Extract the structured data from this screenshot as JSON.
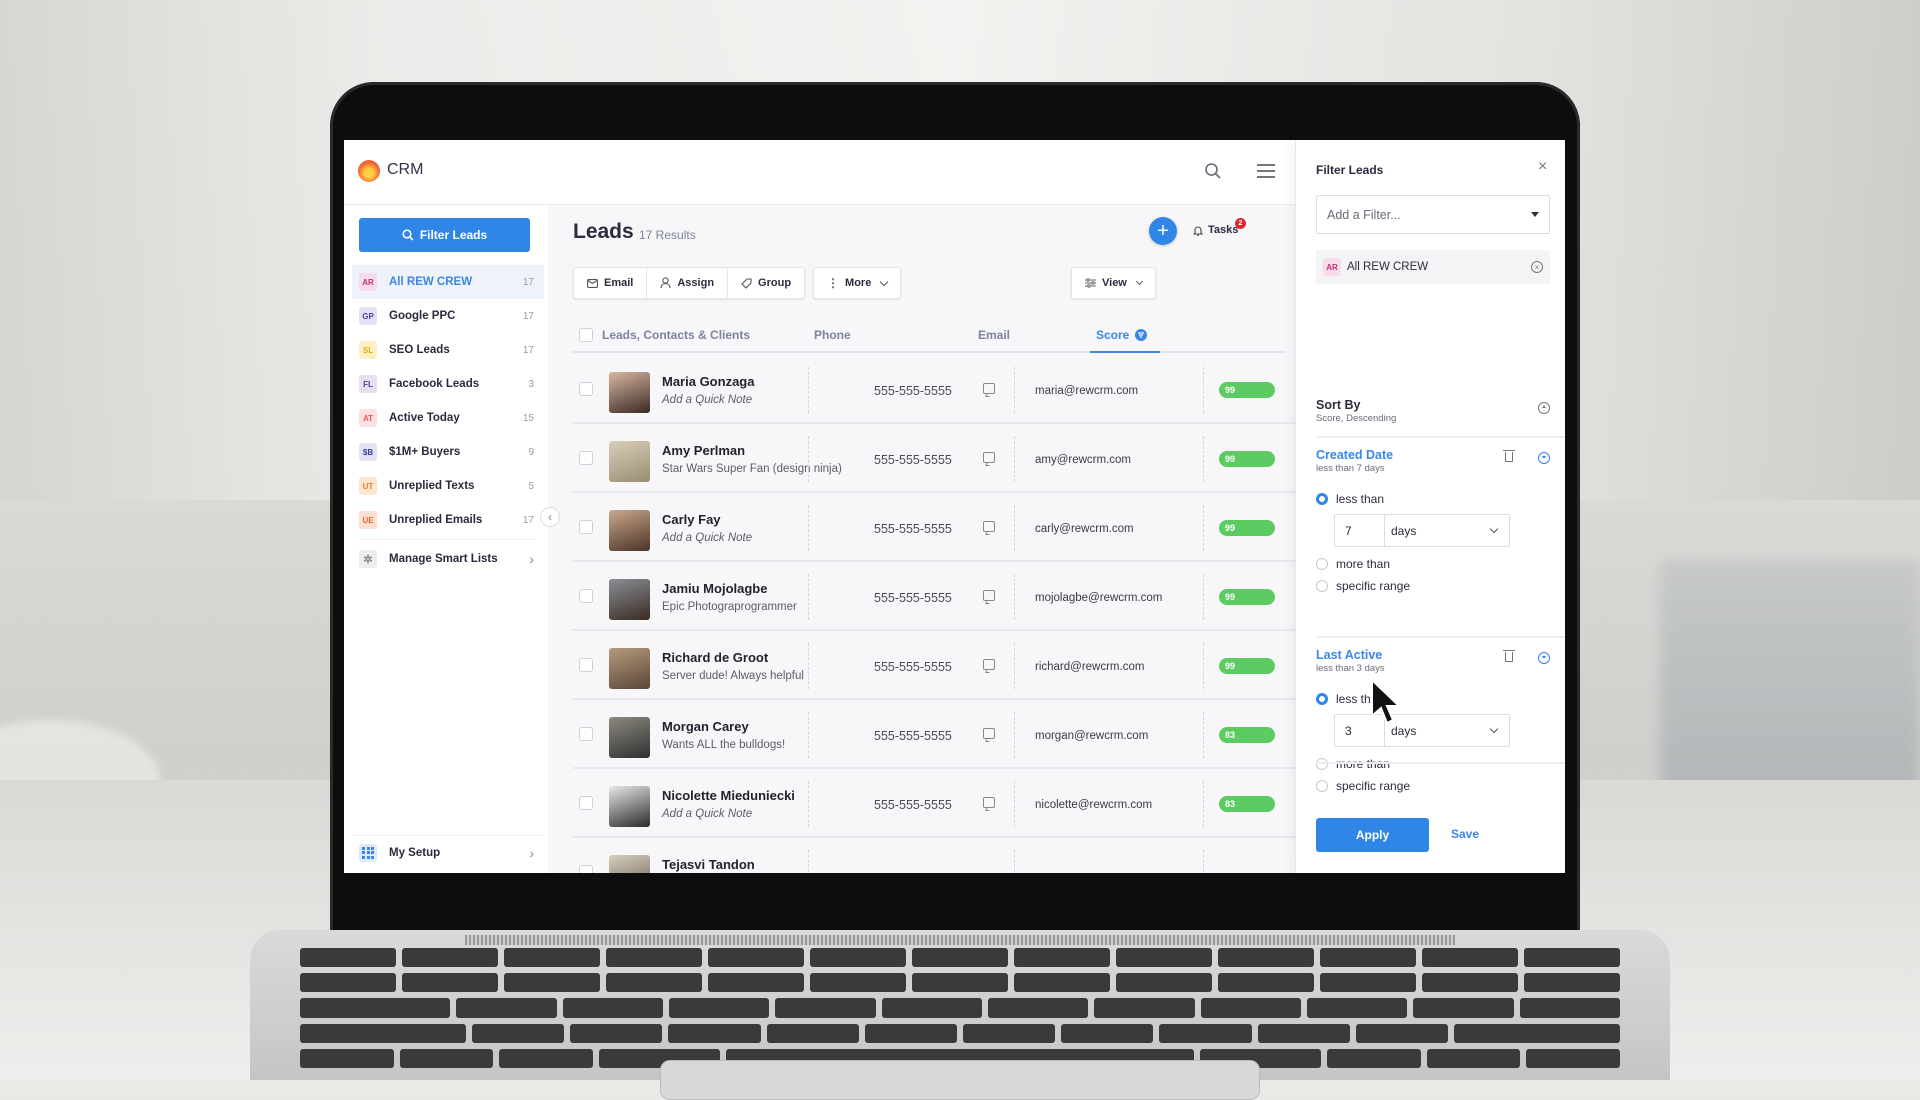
{
  "app": {
    "brand": "CRM"
  },
  "topbar": {
    "search_icon": "search-icon",
    "menu_icon": "hamburger-menu-icon"
  },
  "sidebar": {
    "filter_button": "Filter Leads",
    "items": [
      {
        "abbr": "AR",
        "label": "All REW CREW",
        "count": "17",
        "badge_bg": "#f6dbe8",
        "badge_fg": "#c0327a",
        "active": true
      },
      {
        "abbr": "GP",
        "label": "Google PPC",
        "count": "17",
        "badge_bg": "#e3e1f1",
        "badge_fg": "#4a47a0"
      },
      {
        "abbr": "SL",
        "label": "SEO Leads",
        "count": "17",
        "badge_bg": "#fdf0c4",
        "badge_fg": "#e0a80f"
      },
      {
        "abbr": "FL",
        "label": "Facebook Leads",
        "count": "3",
        "badge_bg": "#e7e0f3",
        "badge_fg": "#5a3f8f"
      },
      {
        "abbr": "AT",
        "label": "Active Today",
        "count": "15",
        "badge_bg": "#fde1e1",
        "badge_fg": "#e55a5a"
      },
      {
        "abbr": "$B",
        "label": "$1M+ Buyers",
        "count": "9",
        "badge_bg": "#e1e2f3",
        "badge_fg": "#3c3f9a"
      },
      {
        "abbr": "UT",
        "label": "Unreplied Texts",
        "count": "5",
        "badge_bg": "#fde6cf",
        "badge_fg": "#e78328"
      },
      {
        "abbr": "UE",
        "label": "Unreplied Emails",
        "count": "17",
        "badge_bg": "#fde0d3",
        "badge_fg": "#e8632c"
      }
    ],
    "manage": "Manage Smart Lists",
    "setup": "My Setup"
  },
  "main": {
    "title": "Leads",
    "results": "17 Results",
    "tasks_label": "Tasks",
    "tasks_count": "2",
    "toolbar": {
      "email": "Email",
      "assign": "Assign",
      "group": "Group",
      "more": "More",
      "view": "View"
    },
    "columns": {
      "name": "Leads, Contacts & Clients",
      "phone": "Phone",
      "email": "Email",
      "score": "Score"
    },
    "rows": [
      {
        "name": "Maria Gonzaga",
        "note": "Add a Quick Note",
        "note_placeholder": true,
        "phone": "555-555-5555",
        "email": "maria@rewcrm.com",
        "score": "99"
      },
      {
        "name": "Amy Perlman",
        "note": "Star Wars Super Fan (design ninja)",
        "note_placeholder": false,
        "phone": "555-555-5555",
        "email": "amy@rewcrm.com",
        "score": "99"
      },
      {
        "name": "Carly Fay",
        "note": "Add a Quick Note",
        "note_placeholder": true,
        "phone": "555-555-5555",
        "email": "carly@rewcrm.com",
        "score": "99"
      },
      {
        "name": "Jamiu Mojolagbe",
        "note": "Epic Photograprogrammer",
        "note_placeholder": false,
        "phone": "555-555-5555",
        "email": "mojolagbe@rewcrm.com",
        "score": "99"
      },
      {
        "name": "Richard de Groot",
        "note": "Server dude! Always helpful",
        "note_placeholder": false,
        "phone": "555-555-5555",
        "email": "richard@rewcrm.com",
        "score": "99"
      },
      {
        "name": "Morgan Carey",
        "note": "Wants ALL the bulldogs!",
        "note_placeholder": false,
        "phone": "555-555-5555",
        "email": "morgan@rewcrm.com",
        "score": "83"
      },
      {
        "name": "Nicolette Mieduniecki",
        "note": "Add a Quick Note",
        "note_placeholder": true,
        "phone": "555-555-5555",
        "email": "nicolette@rewcrm.com",
        "score": "83"
      },
      {
        "name": "Tejasvi Tandon",
        "note": "",
        "note_placeholder": false,
        "phone": "",
        "email": "",
        "score": ""
      }
    ]
  },
  "filter_panel": {
    "title": "Filter Leads",
    "add_filter_placeholder": "Add a Filter...",
    "chip": {
      "abbr": "AR",
      "label": "All REW CREW"
    },
    "sort": {
      "title": "Sort By",
      "value": "Score, Descending"
    },
    "created": {
      "title": "Created Date",
      "summary": "less than 7 days",
      "options": [
        "less than",
        "more than",
        "specific range"
      ],
      "selected": 0,
      "amount": "7",
      "unit": "days"
    },
    "last_active": {
      "title": "Last Active",
      "summary": "less than 3 days",
      "options": [
        "less than",
        "more than",
        "specific range"
      ],
      "selected": 0,
      "amount": "3",
      "unit": "days"
    },
    "apply": "Apply",
    "save": "Save"
  },
  "colors": {
    "accent": "#2f86e6",
    "score_green": "#5ccb62",
    "badge_red": "#e3262f"
  }
}
